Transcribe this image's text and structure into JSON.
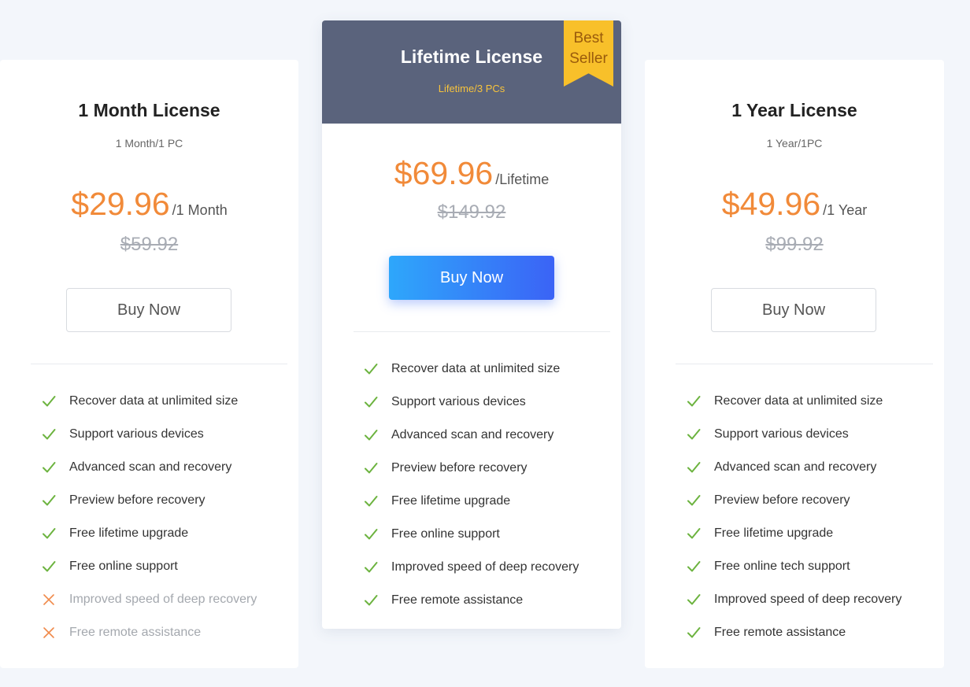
{
  "cards": [
    {
      "title": "1 Month License",
      "subtitle": "1 Month/1 PC",
      "price": "$29.96",
      "period": "/1 Month",
      "old_price": "$59.92",
      "button": "Buy Now",
      "features": [
        {
          "text": "Recover data at unlimited size",
          "included": true
        },
        {
          "text": "Support various devices",
          "included": true
        },
        {
          "text": "Advanced scan and recovery",
          "included": true
        },
        {
          "text": "Preview before recovery",
          "included": true
        },
        {
          "text": "Free lifetime upgrade",
          "included": true
        },
        {
          "text": "Free online support",
          "included": true
        },
        {
          "text": "Improved speed of deep recovery",
          "included": false
        },
        {
          "text": "Free remote assistance",
          "included": false
        }
      ]
    },
    {
      "title": "Lifetime License",
      "subtitle": "Lifetime/3 PCs",
      "badge_line1": "Best",
      "badge_line2": "Seller",
      "price": "$69.96",
      "period": "/Lifetime",
      "old_price": "$149.92",
      "button": "Buy Now",
      "features": [
        {
          "text": "Recover data at unlimited size",
          "included": true
        },
        {
          "text": "Support various devices",
          "included": true
        },
        {
          "text": "Advanced scan and recovery",
          "included": true
        },
        {
          "text": "Preview before recovery",
          "included": true
        },
        {
          "text": "Free lifetime upgrade",
          "included": true
        },
        {
          "text": "Free online support",
          "included": true
        },
        {
          "text": "Improved speed of deep recovery",
          "included": true
        },
        {
          "text": "Free remote assistance",
          "included": true
        }
      ]
    },
    {
      "title": "1 Year License",
      "subtitle": "1 Year/1PC",
      "price": "$49.96",
      "period": "/1 Year",
      "old_price": "$99.92",
      "button": "Buy Now",
      "features": [
        {
          "text": "Recover data at unlimited size",
          "included": true
        },
        {
          "text": "Support various devices",
          "included": true
        },
        {
          "text": "Advanced scan and recovery",
          "included": true
        },
        {
          "text": "Preview before recovery",
          "included": true
        },
        {
          "text": "Free lifetime upgrade",
          "included": true
        },
        {
          "text": "Free online tech support",
          "included": true
        },
        {
          "text": "Improved speed of deep recovery",
          "included": true
        },
        {
          "text": "Free remote assistance",
          "included": true
        }
      ]
    }
  ],
  "icons": {
    "included": "check-icon",
    "excluded": "cross-icon"
  },
  "colors": {
    "price": "#f18a39",
    "check": "#6cb33f",
    "cross": "#f08a4b",
    "header_bg": "#5a637c",
    "badge_bg": "#f8c02a",
    "button_gradient_start": "#2ea7fb",
    "button_gradient_end": "#3b63f6"
  }
}
